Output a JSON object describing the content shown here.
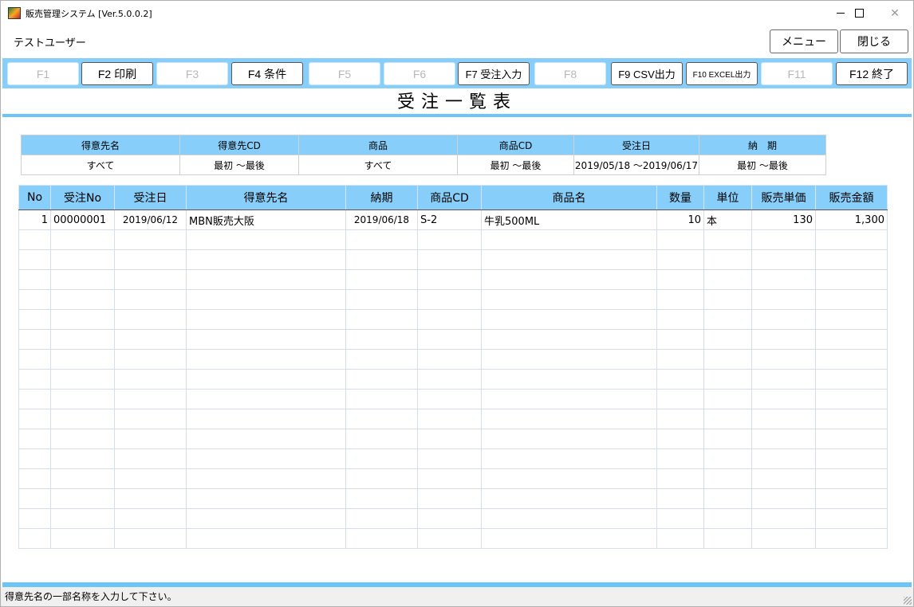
{
  "window": {
    "title": "販売管理システム [Ver.5.0.0.2]"
  },
  "user": {
    "name": "テストユーザー"
  },
  "top_buttons": {
    "menu": "メニュー",
    "close": "閉じる"
  },
  "fkeys": [
    {
      "label": "F1",
      "enabled": false
    },
    {
      "label": "F2 印刷",
      "enabled": true
    },
    {
      "label": "F3",
      "enabled": false
    },
    {
      "label": "F4 条件",
      "enabled": true
    },
    {
      "label": "F5",
      "enabled": false
    },
    {
      "label": "F6",
      "enabled": false
    },
    {
      "label": "F7 受注入力",
      "enabled": true
    },
    {
      "label": "F8",
      "enabled": false
    },
    {
      "label": "F9 CSV出力",
      "enabled": true
    },
    {
      "label": "F10 EXCEL出力",
      "enabled": true
    },
    {
      "label": "F11",
      "enabled": false
    },
    {
      "label": "F12 終了",
      "enabled": true
    }
  ],
  "heading": "受注一覧表",
  "criteria": {
    "headers": [
      "得意先名",
      "得意先CD",
      "商品",
      "商品CD",
      "受注日",
      "納　期"
    ],
    "values": [
      "すべて",
      "最初 ～最後",
      "すべて",
      "最初 ～最後",
      "2019/05/18 ～2019/06/17",
      "最初 ～最後"
    ]
  },
  "grid": {
    "columns": [
      "No",
      "受注No",
      "受注日",
      "得意先名",
      "納期",
      "商品CD",
      "商品名",
      "数量",
      "単位",
      "販売単価",
      "販売金額"
    ],
    "rows": [
      [
        "1",
        "00000001",
        "2019/06/12",
        "MBN販売大阪",
        "2019/06/18",
        "S-2",
        "牛乳500ML",
        "10",
        "本",
        "130",
        "1,300"
      ]
    ],
    "empty_rows": 16
  },
  "status": "得意先名の一部名称を入力して下さい。",
  "colors": {
    "accent": "#87cefa",
    "rule": "#6cc4f8"
  }
}
